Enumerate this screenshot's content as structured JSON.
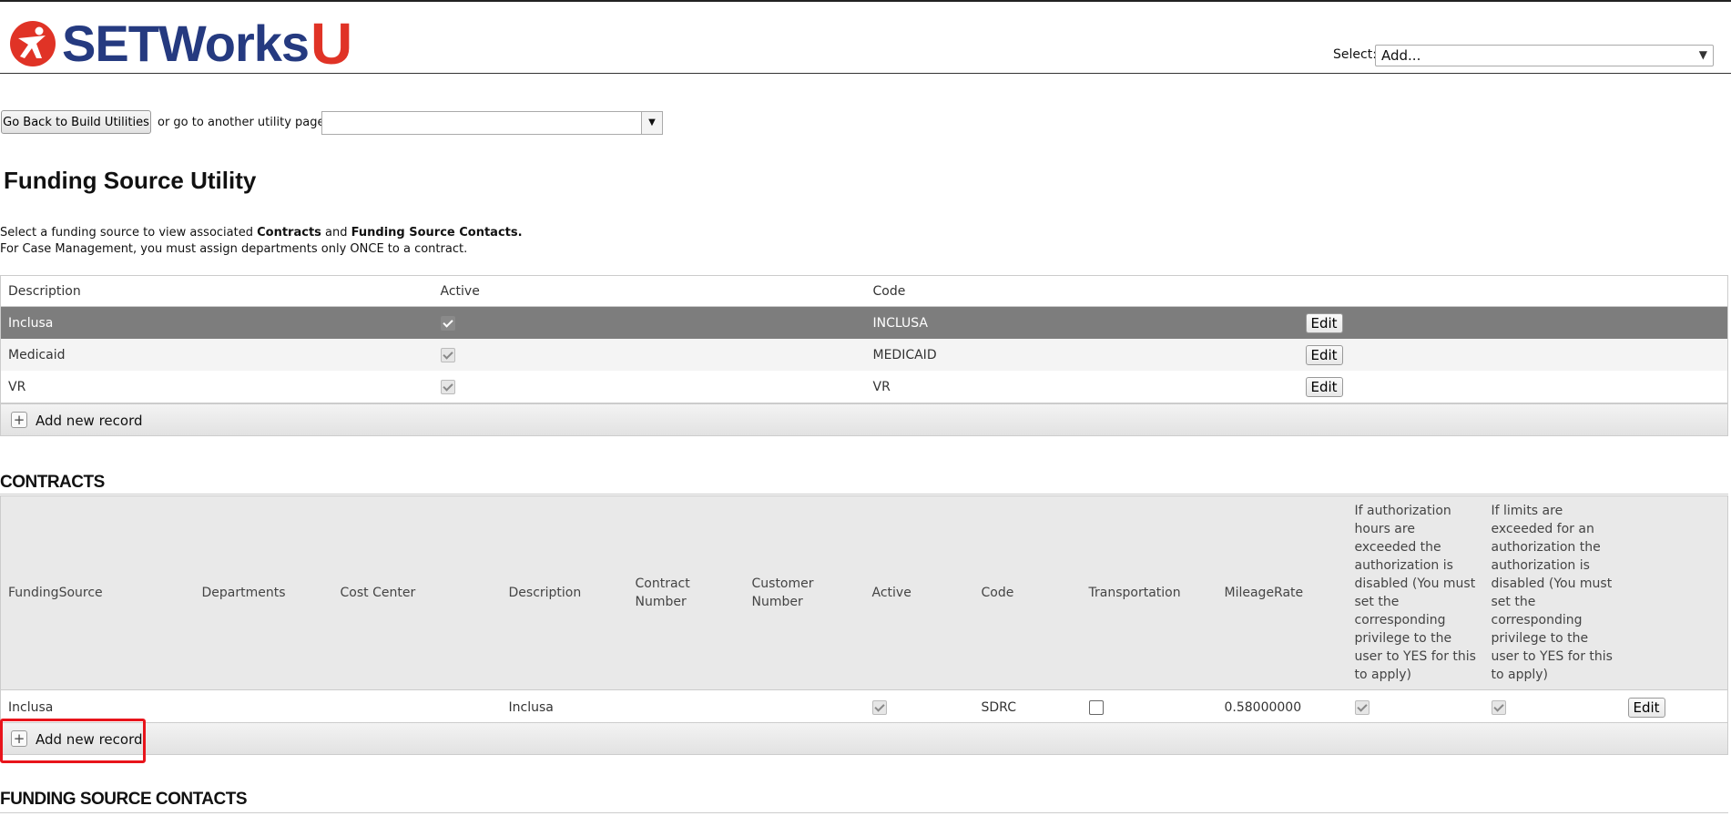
{
  "header": {
    "brand_name": "SETWorks",
    "brand_suffix": "U",
    "select_label": "Select:",
    "select_value": "Add..."
  },
  "nav": {
    "go_back_label": "Go Back to Build Utilities",
    "or_text": "or go to another utility page:",
    "utility_value": ""
  },
  "page": {
    "title": "Funding Source Utility",
    "note1_prefix": "Select a funding source to view associated ",
    "note1_bold1": "Contracts",
    "note1_mid": " and ",
    "note1_bold2": "Funding Source Contacts.",
    "note2": "For Case Management, you must assign departments only ONCE to a contract."
  },
  "funding_sources": {
    "columns": [
      "Description",
      "Active",
      "Code"
    ],
    "rows": [
      {
        "description": "Inclusa",
        "active": true,
        "code": "INCLUSA",
        "edit": "Edit"
      },
      {
        "description": "Medicaid",
        "active": true,
        "code": "MEDICAID",
        "edit": "Edit"
      },
      {
        "description": "VR",
        "active": true,
        "code": "VR",
        "edit": "Edit"
      }
    ],
    "add_label": "Add new record"
  },
  "contracts": {
    "title": "CONTRACTS",
    "columns": [
      "FundingSource",
      "Departments",
      "Cost Center",
      "Description",
      "Contract Number",
      "Customer Number",
      "Active",
      "Code",
      "Transportation",
      "MileageRate",
      "If authorization hours are exceeded the authorization is disabled (You must set the corresponding privilege to the user to YES for this to apply)",
      "If limits are exceeded for an authorization the authorization is disabled (You must set the corresponding privilege to the user to YES for this to apply)"
    ],
    "rows": [
      {
        "funding_source": "Inclusa",
        "departments": "",
        "cost_center": "",
        "description": "Inclusa",
        "contract_number": "",
        "customer_number": "",
        "active": true,
        "code": "SDRC",
        "transportation": false,
        "mileage_rate": "0.58000000",
        "auth_hours": true,
        "auth_limits": true,
        "edit": "Edit"
      }
    ],
    "add_label": "Add new record"
  },
  "contacts": {
    "title": "FUNDING SOURCE CONTACTS"
  },
  "colors": {
    "brand_blue": "#253a80",
    "brand_red": "#e03326",
    "selected_row": "#7d7d7d",
    "highlight": "#e8141b"
  },
  "icons": {
    "logo": "runner-logo-icon",
    "dropdown": "chevron-down-icon",
    "add": "plus-icon",
    "checkbox": "checkbox-icon"
  }
}
